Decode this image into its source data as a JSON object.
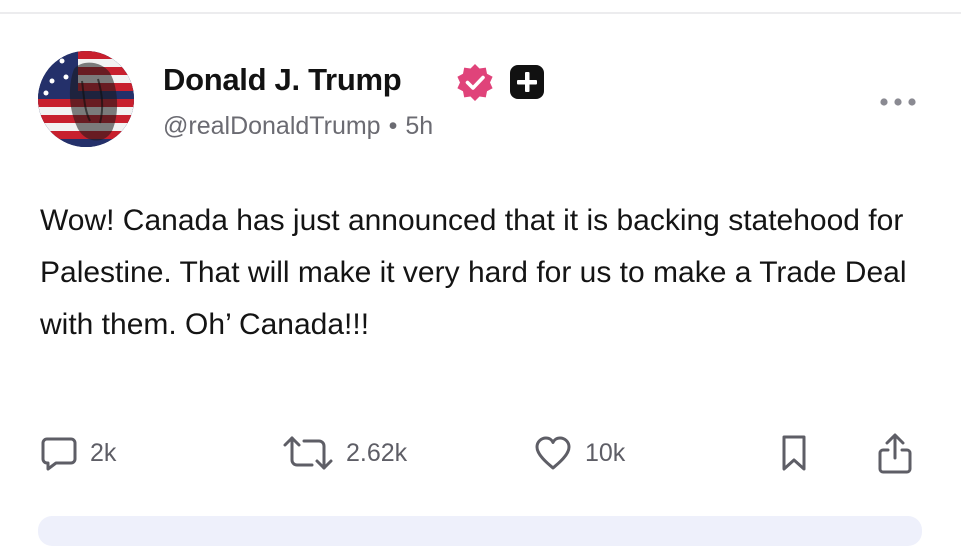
{
  "author": {
    "display_name": "Donald J. Trump",
    "handle": "@realDonaldTrump",
    "separator": "•",
    "time_ago": "5h",
    "verified_badge_color": "#e0437a",
    "plus_badge_color": "#111111"
  },
  "post": {
    "text": "Wow! Canada has just announced that it is backing statehood for Palestine. That will make it very hard for us to make a Trade Deal with them. Oh’ Canada!!!"
  },
  "actions": {
    "reply_count": "2k",
    "repost_count": "2.62k",
    "like_count": "10k"
  },
  "icons": {
    "more": "more-horizontal-icon",
    "reply": "comment-bubble-icon",
    "repost": "repost-arrows-icon",
    "like": "heart-icon",
    "bookmark": "bookmark-icon",
    "share": "share-upload-icon"
  },
  "colors": {
    "text_primary": "#141414",
    "text_secondary": "#6b6b72",
    "icon_gray": "#5e5e66",
    "card_tint": "#eef0fb"
  }
}
